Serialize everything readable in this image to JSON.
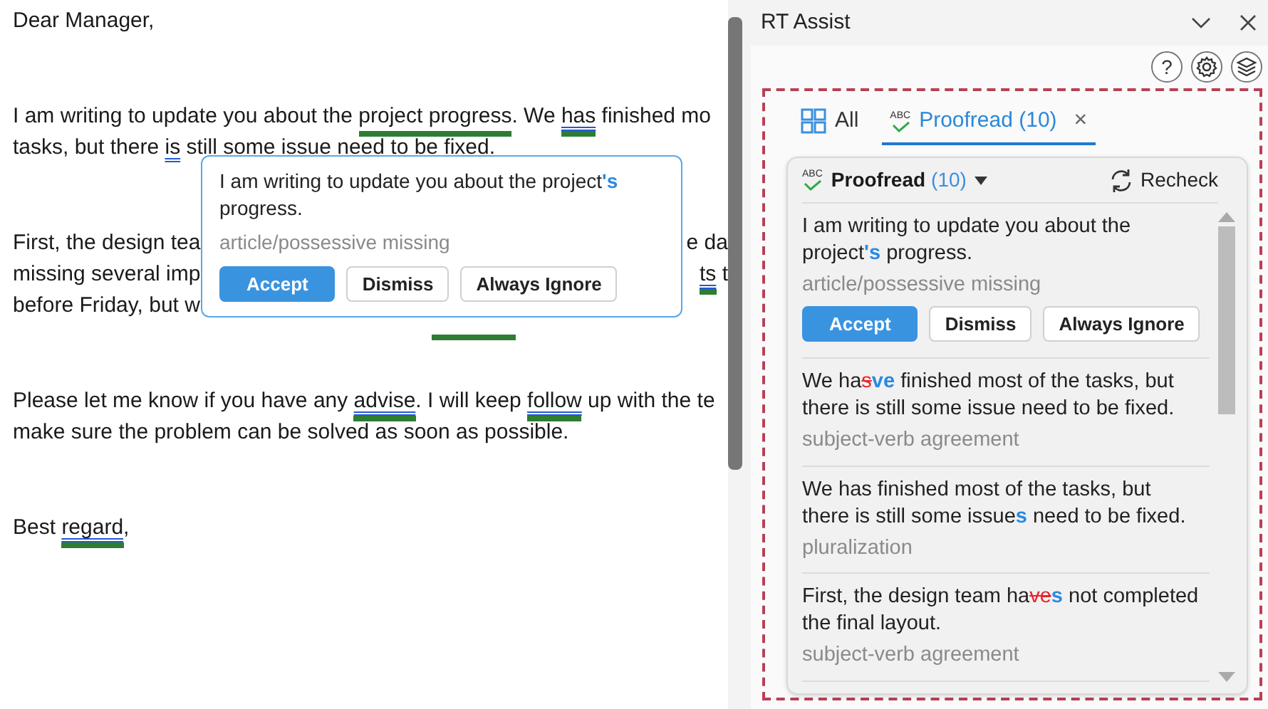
{
  "document": {
    "paragraphs": [
      {
        "lines": [
          {
            "segments": [
              {
                "kind": "text",
                "text": "Dear Manager,"
              }
            ]
          }
        ]
      },
      {
        "lines": [
          {
            "segments": [
              {
                "kind": "text",
                "text": "I am writing to update you about the "
              },
              {
                "kind": "flag",
                "text": "project progress",
                "double": false,
                "bar": true
              },
              {
                "kind": "text",
                "text": ". We "
              },
              {
                "kind": "flag",
                "text": "has",
                "double": true,
                "bar": true
              },
              {
                "kind": "text",
                "text": " finished mo"
              }
            ]
          },
          {
            "segments": [
              {
                "kind": "text",
                "text": "tasks, but there "
              },
              {
                "kind": "flag",
                "text": "is",
                "double": true,
                "bar": false
              },
              {
                "kind": "text",
                "text": " still some issue need to be fixed."
              }
            ]
          }
        ]
      },
      {
        "lines": [
          {
            "segments": [
              {
                "kind": "text",
                "text": "First, the design tea"
              },
              {
                "kind": "right",
                "text": "e da"
              }
            ]
          },
          {
            "segments": [
              {
                "kind": "text",
                "text": "missing several imp"
              },
              {
                "kind": "rightflag",
                "text": "ts",
                "double": true,
                "bar": true
              },
              {
                "kind": "text",
                "text": " t"
              }
            ]
          },
          {
            "segments": [
              {
                "kind": "text",
                "text": "before Friday, but w"
              },
              {
                "kind": "hidden",
                "bar": true
              }
            ]
          }
        ]
      },
      {
        "lines": [
          {
            "segments": [
              {
                "kind": "text",
                "text": "Please let me know if you have any "
              },
              {
                "kind": "flag",
                "text": "advise",
                "double": true,
                "bar": true
              },
              {
                "kind": "text",
                "text": ". I will keep "
              },
              {
                "kind": "flag",
                "text": "follow",
                "double": true,
                "bar": true
              },
              {
                "kind": "text",
                "text": " up with the te"
              }
            ]
          },
          {
            "segments": [
              {
                "kind": "text",
                "text": "make sure the problem can be solved as soon as possible."
              }
            ]
          }
        ]
      },
      {
        "lines": [
          {
            "segments": [
              {
                "kind": "text",
                "text": "Best "
              },
              {
                "kind": "flag",
                "text": "regard",
                "double": true,
                "bar": true
              },
              {
                "kind": "text",
                "text": ","
              }
            ]
          }
        ]
      }
    ]
  },
  "popup": {
    "sentence": [
      {
        "kind": "plain",
        "text": "I am writing to update you about the project"
      },
      {
        "kind": "insert",
        "text": "'s"
      },
      {
        "kind": "plain",
        "text": " progress."
      }
    ],
    "note": "article/possessive missing",
    "buttons": [
      {
        "label": "Accept",
        "primary": true
      },
      {
        "label": "Dismiss",
        "primary": false
      },
      {
        "label": "Always Ignore",
        "primary": false
      }
    ]
  },
  "panel": {
    "title": "RT Assist",
    "help_label": "?",
    "tabs": [
      {
        "kind": "all",
        "label": "All",
        "selected": false
      },
      {
        "kind": "proofread",
        "badge": "ABC",
        "label": "Proofread (10)",
        "selected": true,
        "close": "×"
      }
    ],
    "card": {
      "badge": "ABC",
      "title": "Proofread",
      "count": "(10)",
      "recheck": "Recheck",
      "suggestions": [
        {
          "sentence": [
            {
              "kind": "plain",
              "text": "I am writing to update you about the project"
            },
            {
              "kind": "insert",
              "text": "'s"
            },
            {
              "kind": "plain",
              "text": " progress."
            }
          ],
          "note": "article/possessive missing",
          "buttons": [
            {
              "label": "Accept",
              "primary": true
            },
            {
              "label": "Dismiss",
              "primary": false
            },
            {
              "label": "Always Ignore",
              "primary": false
            }
          ]
        },
        {
          "sentence": [
            {
              "kind": "plain",
              "text": "We ha"
            },
            {
              "kind": "delete",
              "text": "s"
            },
            {
              "kind": "insert",
              "text": "ve"
            },
            {
              "kind": "plain",
              "text": " finished most of the tasks, but there is still some issue need to be fixed."
            }
          ],
          "note": "subject-verb agreement"
        },
        {
          "sentence": [
            {
              "kind": "plain",
              "text": "We has finished most of the tasks, but there is still some issue"
            },
            {
              "kind": "insert",
              "text": "s"
            },
            {
              "kind": "plain",
              "text": " need to be fixed."
            }
          ],
          "note": "pluralization"
        },
        {
          "sentence": [
            {
              "kind": "plain",
              "text": "First, the design team ha"
            },
            {
              "kind": "delete",
              "text": "ve"
            },
            {
              "kind": "insert",
              "text": "s"
            },
            {
              "kind": "plain",
              "text": " not completed the final layout."
            }
          ],
          "note": "subject-verb agreement"
        }
      ]
    }
  }
}
